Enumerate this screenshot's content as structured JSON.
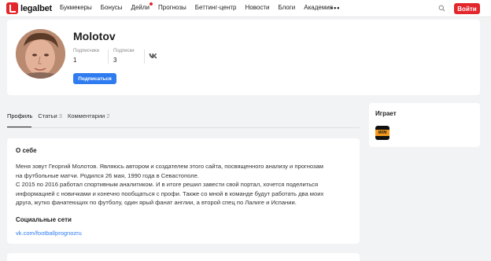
{
  "header": {
    "logo_text": "legalbet",
    "nav": [
      "Букмекеры",
      "Бонусы",
      "Дейли",
      "Прогнозы",
      "Беттинг-центр",
      "Новости",
      "Блоги",
      "Академия"
    ],
    "more": "•••",
    "login_label": "Войти",
    "accent_color": "#e3262b"
  },
  "profile": {
    "name": "Molotov",
    "subscribers_label": "Подписчики",
    "subscribers_value": "1",
    "subscriptions_label": "Подписки",
    "subscriptions_value": "3",
    "subscribe_label": "Подписаться",
    "social_icon": "vk-icon"
  },
  "tabs": [
    {
      "label": "Профиль",
      "count": ""
    },
    {
      "label": "Статьи",
      "count": "3"
    },
    {
      "label": "Комментарии",
      "count": "2"
    }
  ],
  "about": {
    "title": "О себе",
    "lines": [
      "Меня зовут Георгий Молотов. Являюсь автором и создателем этого сайта, посвященного анализу и прогнозам",
      "на футбольные матчи. Родился 26 мая, 1990 года в Севастополе.",
      "С 2015 по 2016 работал спортивным аналитиком. И в итоге решил завести свой портал, хочется поделиться",
      "информацией с новичками и конечно пообщаться с профи. Также со мной в команде будут работать два моих",
      "друга, жутко фанатеющих по футболу, один ярый фанат англии, а второй спец по Лалиге и Испании."
    ],
    "social_title": "Социальные сети",
    "social_link": "vk.com/footballprognozru"
  },
  "plays": {
    "title": "Играет",
    "bookmaker_logo_text": "WIN"
  }
}
